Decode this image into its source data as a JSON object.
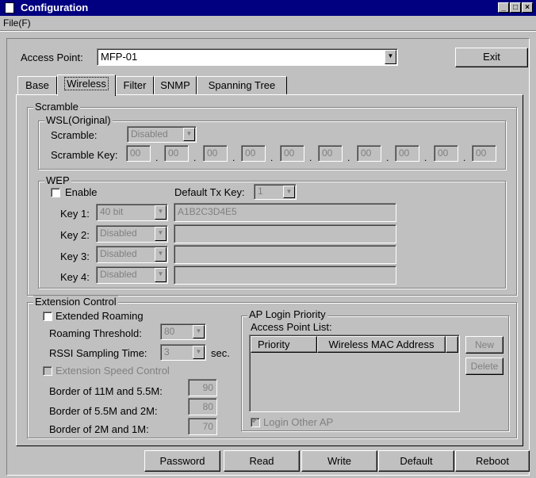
{
  "window": {
    "title": "Configuration"
  },
  "menu": {
    "file": "File(F)"
  },
  "access_point": {
    "label": "Access Point:",
    "value": "MFP-01"
  },
  "exit_label": "Exit",
  "tabs": [
    {
      "label": "Base"
    },
    {
      "label": "Wireless",
      "selected": true
    },
    {
      "label": "Filter"
    },
    {
      "label": "SNMP"
    },
    {
      "label": "Spanning Tree"
    }
  ],
  "scramble": {
    "group_label": "Scramble",
    "wsl_label": "WSL(Original)",
    "scramble_label": "Scramble:",
    "scramble_value": "Disabled",
    "key_label": "Scramble Key:",
    "key_values": [
      "00",
      "00",
      "00",
      "00",
      "00",
      "00",
      "00",
      "00",
      "00",
      "00"
    ]
  },
  "wep": {
    "group_label": "WEP",
    "enable_label": "Enable",
    "enabled": false,
    "default_tx_label": "Default Tx Key:",
    "default_tx_value": "1",
    "keys": [
      {
        "label": "Key 1:",
        "type": "40 bit",
        "value": "A1B2C3D4E5"
      },
      {
        "label": "Key 2:",
        "type": "Disabled",
        "value": ""
      },
      {
        "label": "Key 3:",
        "type": "Disabled",
        "value": ""
      },
      {
        "label": "Key 4:",
        "type": "Disabled",
        "value": ""
      }
    ]
  },
  "extension": {
    "group_label": "Extension Control",
    "extended_roaming_label": "Extended Roaming",
    "roaming_threshold_label": "Roaming Threshold:",
    "roaming_threshold_value": "80",
    "rssi_label": "RSSI Sampling Time:",
    "rssi_value": "3",
    "rssi_unit": "sec.",
    "speed_control_label": "Extension Speed Control",
    "borders": [
      {
        "label": "Border of 11M and 5.5M:",
        "value": "90"
      },
      {
        "label": "Border of 5.5M and 2M:",
        "value": "80"
      },
      {
        "label": "Border of 2M and 1M:",
        "value": "70"
      }
    ]
  },
  "ap_login": {
    "group_label": "AP Login Priority",
    "list_label": "Access Point List:",
    "columns": [
      "Priority",
      "Wireless MAC Address"
    ],
    "new_label": "New",
    "delete_label": "Delete",
    "login_other_label": "Login Other AP",
    "login_other_checked": true
  },
  "bottom_buttons": [
    "Password",
    "Read",
    "Write",
    "Default",
    "Reboot"
  ]
}
